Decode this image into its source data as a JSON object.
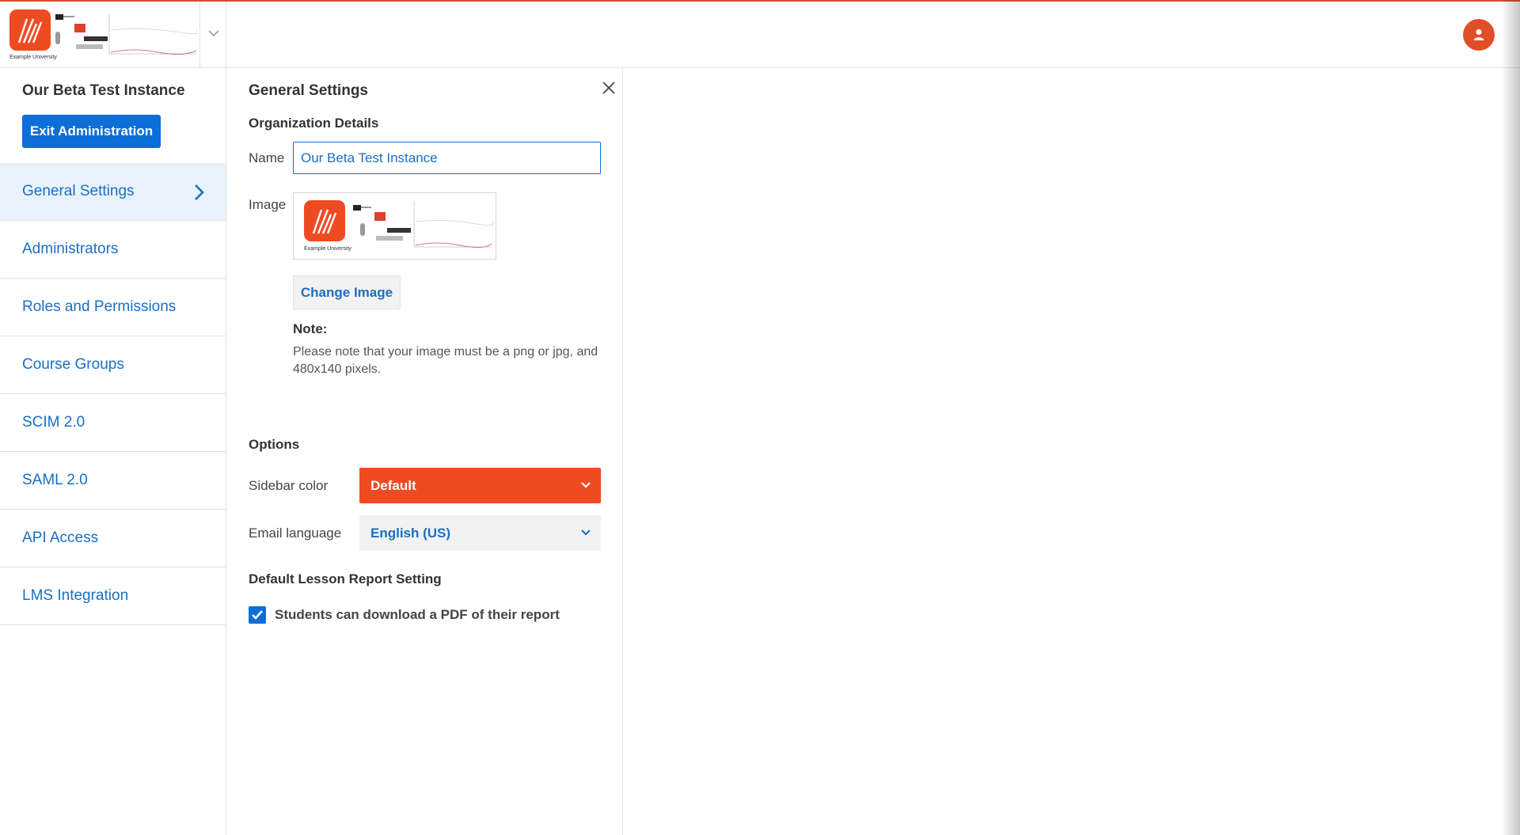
{
  "topbar": {
    "logo_caption": "Example University",
    "accent_color": "#e04e28"
  },
  "sidebar": {
    "org_name": "Our Beta Test Instance",
    "exit_label": "Exit Administration",
    "items": [
      {
        "label": "General Settings",
        "active": true
      },
      {
        "label": "Administrators"
      },
      {
        "label": "Roles and Permissions"
      },
      {
        "label": "Course Groups"
      },
      {
        "label": "SCIM 2.0"
      },
      {
        "label": "SAML 2.0"
      },
      {
        "label": "API Access"
      },
      {
        "label": "LMS Integration"
      }
    ]
  },
  "panel": {
    "title": "General Settings",
    "org_details_heading": "Organization Details",
    "name_label": "Name",
    "name_value": "Our Beta Test Instance",
    "image_label": "Image",
    "change_image_label": "Change Image",
    "note_heading": "Note:",
    "note_text": "Please note that your image must be a png or jpg, and 480x140 pixels.",
    "options_heading": "Options",
    "sidebar_color_label": "Sidebar color",
    "sidebar_color_value": "Default",
    "email_language_label": "Email language",
    "email_language_value": "English (US)",
    "lesson_report_heading": "Default Lesson Report Setting",
    "pdf_checkbox_label": "Students can download a PDF of their report",
    "pdf_checkbox_checked": true
  },
  "colors": {
    "primary_blue": "#0a6fd6",
    "link_blue": "#1a6fc4",
    "sidebar_default_orange": "#ef4b23"
  }
}
